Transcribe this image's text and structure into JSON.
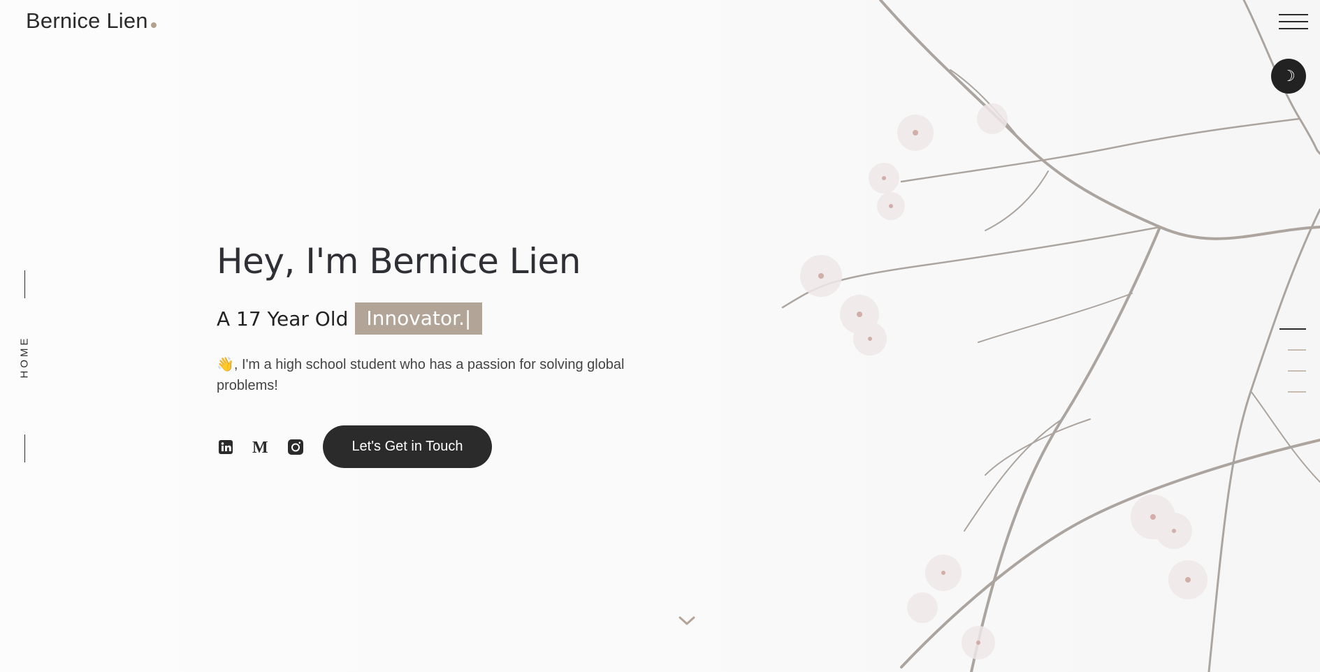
{
  "brand": {
    "name": "Bernice Lien",
    "accent_color": "#b2a28d"
  },
  "header": {
    "menu_icon": "hamburger-icon",
    "theme_toggle_icon": "moon-icon",
    "theme_toggle_glyph": "☽"
  },
  "side": {
    "section_label": "HOME"
  },
  "hero": {
    "title": "Hey, I'm Bernice Lien",
    "subtitle_prefix": "A 17 Year Old",
    "role": "Innovator.|",
    "wave_emoji": "👋",
    "description": ", I'm a high school student who has a passion for solving global problems!",
    "cta_label": "Let's Get in Touch"
  },
  "social": [
    {
      "name": "linkedin-icon"
    },
    {
      "name": "medium-icon"
    },
    {
      "name": "instagram-icon"
    }
  ],
  "section_nav": {
    "items": 4,
    "active_index": 0,
    "active_color": "#2b2b2b",
    "inactive_color": "#c9bcae"
  },
  "scroll_indicator_icon": "chevron-down-icon"
}
